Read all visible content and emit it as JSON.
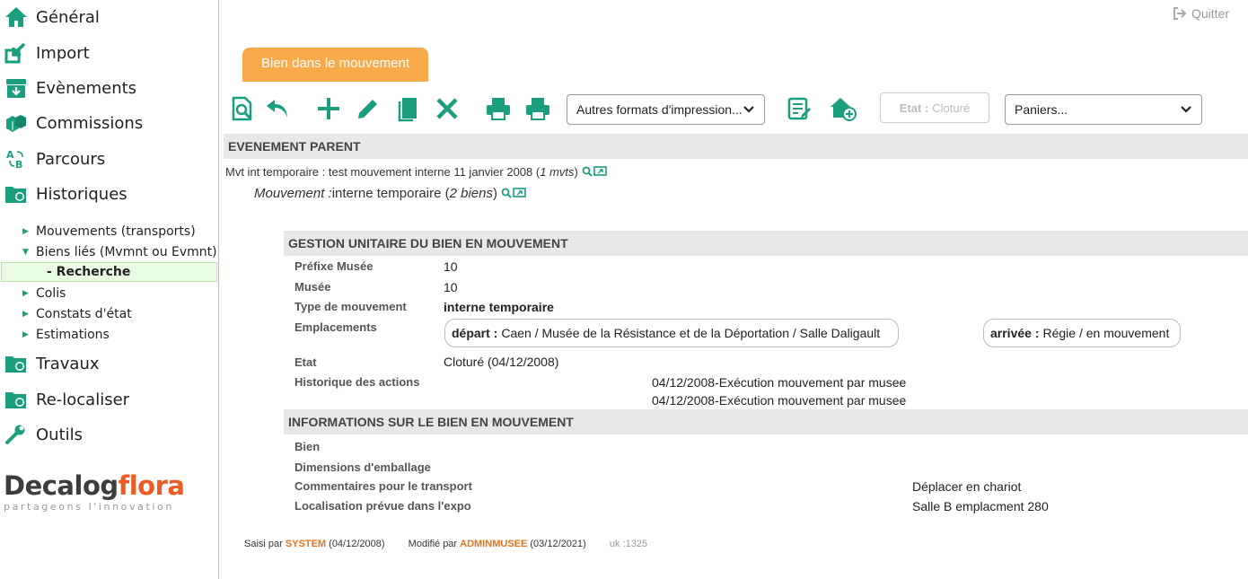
{
  "sidebar": {
    "main": [
      {
        "label": "Général",
        "icon": "home-icon"
      },
      {
        "label": "Import",
        "icon": "import-icon"
      },
      {
        "label": "Evènements",
        "icon": "events-icon"
      },
      {
        "label": "Commissions",
        "icon": "commissions-icon"
      },
      {
        "label": "Parcours",
        "icon": "parcours-icon"
      },
      {
        "label": "Historiques",
        "icon": "historiques-icon"
      }
    ],
    "sub": [
      {
        "label": "Mouvements (transports)",
        "expanded": false
      },
      {
        "label": "Biens liés (Mvmnt ou Evmnt)",
        "expanded": true
      },
      {
        "label": "- Recherche",
        "active": true
      },
      {
        "label": "Colis",
        "expanded": false
      },
      {
        "label": "Constats d'état",
        "expanded": false
      },
      {
        "label": "Estimations",
        "expanded": false
      }
    ],
    "bottom": [
      {
        "label": "Travaux",
        "icon": "travaux-icon"
      },
      {
        "label": "Re-localiser",
        "icon": "relocaliser-icon"
      },
      {
        "label": "Outils",
        "icon": "wrench-icon"
      }
    ],
    "logo": {
      "brand_dark": "Decalog",
      "brand_orange": "flora",
      "tagline": "partageons l'innovation"
    }
  },
  "header": {
    "quit_label": "Quitter"
  },
  "tab": {
    "label": "Bien dans le mouvement"
  },
  "toolbar": {
    "print_formats": "Autres formats d'impression...",
    "etat_label": "Etat :",
    "etat_value": "Cloturé",
    "paniers": "Paniers..."
  },
  "parent": {
    "title": "EVENEMENT PARENT",
    "line1_text": "Mvt int temporaire : test mouvement interne 11 janvier 2008 (",
    "line1_count": "1 mvts",
    "line1_close": ")",
    "line2_label": "Mouvement :",
    "line2_text": " interne temporaire (",
    "line2_count": " 2 biens",
    "line2_close": ")"
  },
  "gestion": {
    "title": "GESTION UNITAIRE DU BIEN EN MOUVEMENT",
    "prefixe_label": "Préfixe Musée",
    "prefixe_value": "10",
    "musee_label": "Musée",
    "musee_value": "10",
    "type_label": "Type de mouvement",
    "type_value": "interne temporaire",
    "emplacements_label": "Emplacements",
    "depart_label": "départ :",
    "depart_value": "Caen / Musée de la Résistance et de la Déportation / Salle Daligault",
    "arrivee_label": "arrivée :",
    "arrivee_value": "Régie / en mouvement",
    "etat_label": "Etat",
    "etat_value": "Cloturé (04/12/2008)",
    "historique_label": "Historique des actions",
    "historique": [
      "04/12/2008-Exécution mouvement par musee",
      "04/12/2008-Exécution mouvement par musee"
    ]
  },
  "infos": {
    "title": "INFORMATIONS SUR LE BIEN EN MOUVEMENT",
    "bien_label": "Bien",
    "dimensions_label": "Dimensions d'emballage",
    "commentaires_label": "Commentaires pour le transport",
    "commentaires_value": "Déplacer en chariot",
    "localisation_label": "Localisation prévue dans l'expo",
    "localisation_value": "Salle B emplacment 280"
  },
  "footer": {
    "saisi_label": "Saisi par",
    "saisi_user": "SYSTEM",
    "saisi_date": "(04/12/2008)",
    "modifie_label": "Modifié par",
    "modifie_user": "ADMINMUSEE",
    "modifie_date": "(03/12/2021)",
    "uk": "uk :1325"
  },
  "colors": {
    "accent": "#1a9e7e",
    "tab": "#f8a94a",
    "brand_orange": "#ee5a24"
  }
}
